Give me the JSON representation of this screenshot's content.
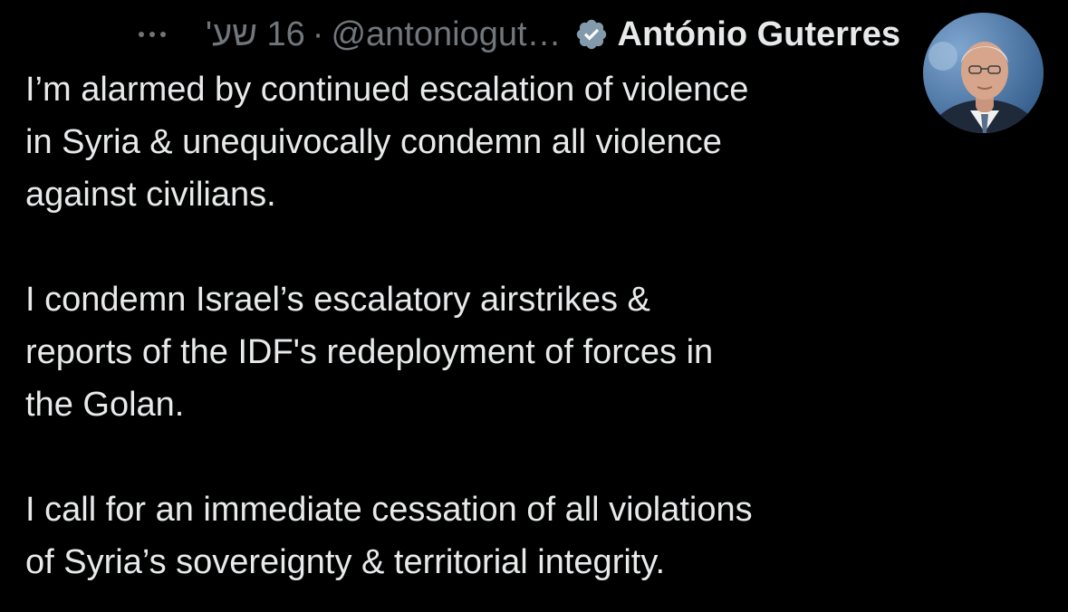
{
  "tweet": {
    "author": {
      "display_name": "António Guterres",
      "handle": "@antoniogut…",
      "verified_icon": "verified-badge-icon",
      "avatar_icon": "portrait-avatar"
    },
    "separator": "·",
    "timestamp": "16 שע'",
    "more_icon": "more-dots-icon",
    "paragraphs": [
      {
        "lines": [
          "I’m alarmed by continued escalation of violence",
          "in Syria & unequivocally condemn all violence",
          "against civilians."
        ]
      },
      {
        "lines": [
          "I condemn Israel’s escalatory airstrikes &",
          "reports of the IDF's redeployment of forces in",
          "the Golan."
        ]
      },
      {
        "lines": [
          "I call for an immediate cessation of all violations",
          "of Syria’s sovereignty & territorial integrity."
        ]
      }
    ]
  },
  "colors": {
    "background": "#000000",
    "text_primary": "#e7e9ea",
    "text_secondary": "#71767b",
    "verified_badge": "#829aab"
  }
}
